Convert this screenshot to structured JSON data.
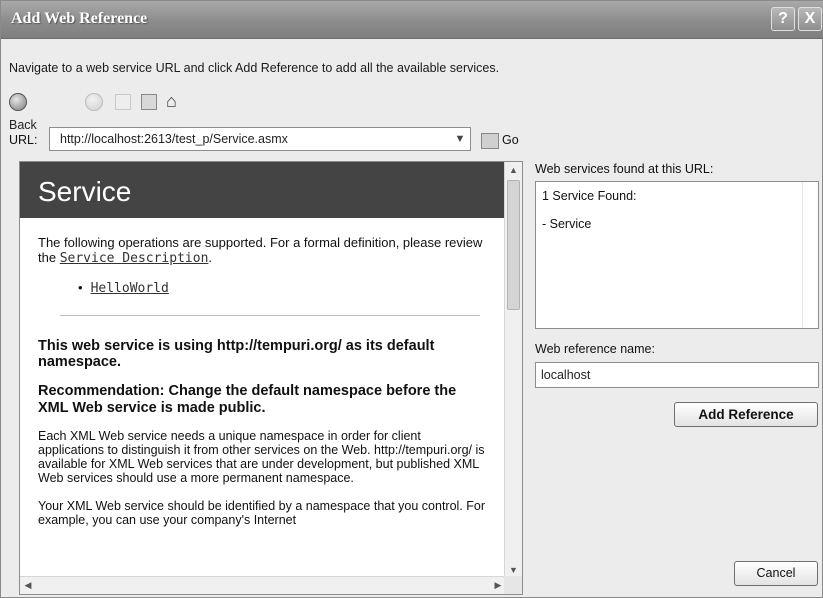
{
  "window": {
    "title": "Add Web Reference",
    "help_glyph": "?",
    "close_glyph": "X"
  },
  "instructions": "Navigate to a web service URL and click Add Reference to add all the available services.",
  "toolbar": {
    "back_label": "Back"
  },
  "url": {
    "label": "URL:",
    "value": "http://localhost:2613/test_p/Service.asmx",
    "go_label": "Go"
  },
  "browser": {
    "banner": "Service",
    "intro_text": "The following operations are supported. For a formal definition, please review the ",
    "service_description_link": "Service Description",
    "intro_end": ".",
    "operations": [
      "HelloWorld"
    ],
    "namespace_heading": "This web service is using http://tempuri.org/ as its default namespace.",
    "recommendation_heading": "Recommendation: Change the default namespace before the XML Web service is made public.",
    "paragraph1": "Each XML Web service needs a unique namespace in order for client applications to distinguish it from other services on the Web. http://tempuri.org/ is available for XML Web services that are under development, but published XML Web services should use a more permanent namespace.",
    "paragraph2": "Your XML Web service should be identified by a namespace that you control. For example, you can use your company's Internet"
  },
  "found": {
    "label": "Web services found at this URL:",
    "count_text": "1 Service Found:",
    "items": [
      "- Service"
    ]
  },
  "reference": {
    "label": "Web reference name:",
    "value": "localhost"
  },
  "buttons": {
    "add_reference": "Add Reference",
    "cancel": "Cancel"
  },
  "icons": {
    "back": "back-arrow-icon",
    "forward": "forward-arrow-icon",
    "stop": "stop-icon",
    "refresh": "refresh-icon",
    "home": "home-icon",
    "go": "go-icon"
  }
}
